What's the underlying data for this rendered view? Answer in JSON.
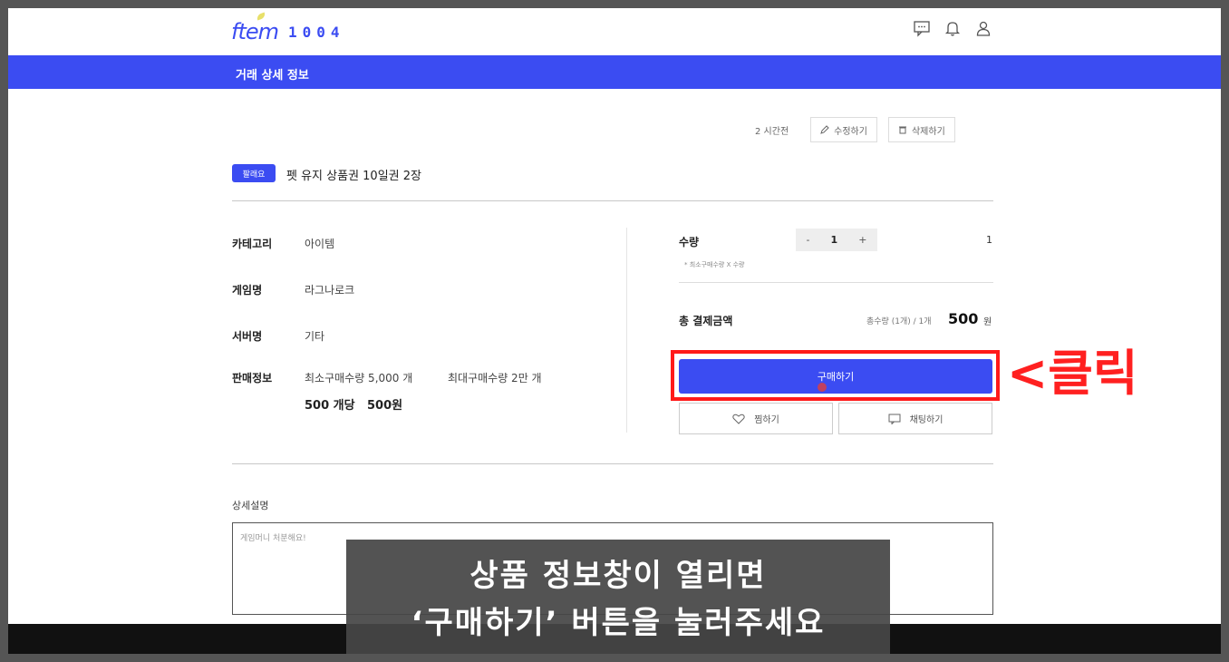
{
  "header": {
    "logo_script": "ftem",
    "logo_number": "1004",
    "icons": [
      "chat-icon",
      "bell-icon",
      "user-icon"
    ]
  },
  "banner": {
    "title": "거래 상세 정보"
  },
  "post_meta": {
    "time_ago": "2 시간전",
    "edit_label": "수정하기",
    "delete_label": "삭제하기"
  },
  "product": {
    "badge": "팔래요",
    "title": "펫 유지 상품권 10일권 2장"
  },
  "info": {
    "category_label": "카테고리",
    "category_value": "아이템",
    "game_label": "게임명",
    "game_value": "라그나로크",
    "server_label": "서버명",
    "server_value": "기타",
    "sale_label": "판매정보",
    "min_qty": "최소구매수량 5,000 개",
    "max_qty": "최대구매수량 2만 개",
    "per_unit": "500 개당",
    "price": "500원"
  },
  "order": {
    "qty_label": "수량",
    "minus": "-",
    "qty_value": "1",
    "plus": "+",
    "qty_right": "1",
    "qty_note": "* 최소구매수량 X 수량",
    "total_label": "총 결제금액",
    "total_qty": "총수량 (1개) / 1개",
    "total_amount": "500",
    "total_unit": "원",
    "buy_label": "구매하기",
    "wish_label": "찜하기",
    "chat_label": "채팅하기"
  },
  "annotation": {
    "click_text": "<클릭"
  },
  "description": {
    "label": "상세설명",
    "text": "게임머니 처분해요!"
  },
  "caption": {
    "line1": "상품 정보창이 열리면",
    "line2": "‘구매하기’ 버튼을 눌러주세요"
  },
  "colors": {
    "brand": "#3b4cf2",
    "highlight": "#ff1a1a"
  }
}
